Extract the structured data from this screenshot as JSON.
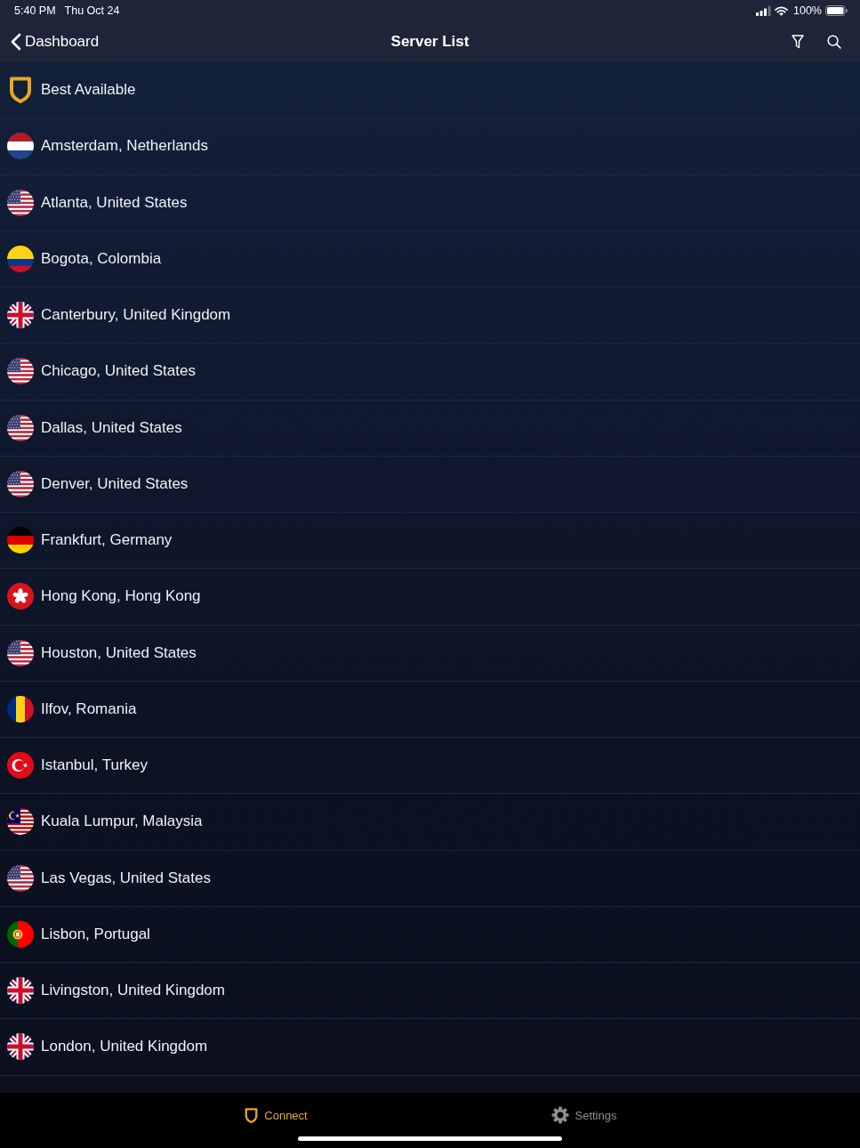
{
  "status_bar": {
    "time": "5:40 PM",
    "date": "Thu Oct 24",
    "battery": "100%"
  },
  "nav": {
    "back": "Dashboard",
    "title": "Server List"
  },
  "servers": [
    {
      "kind": "shield",
      "name": "Best Available"
    },
    {
      "kind": "nl",
      "name": "Amsterdam, Netherlands"
    },
    {
      "kind": "us",
      "name": "Atlanta, United States"
    },
    {
      "kind": "co",
      "name": "Bogota, Colombia"
    },
    {
      "kind": "gb",
      "name": "Canterbury, United Kingdom"
    },
    {
      "kind": "us",
      "name": "Chicago, United States"
    },
    {
      "kind": "us",
      "name": "Dallas, United States"
    },
    {
      "kind": "us",
      "name": "Denver, United States"
    },
    {
      "kind": "de",
      "name": "Frankfurt, Germany"
    },
    {
      "kind": "hk",
      "name": "Hong Kong, Hong Kong"
    },
    {
      "kind": "us",
      "name": "Houston, United States"
    },
    {
      "kind": "ro",
      "name": "Ilfov, Romania"
    },
    {
      "kind": "tr",
      "name": "Istanbul, Turkey"
    },
    {
      "kind": "my",
      "name": "Kuala Lumpur, Malaysia"
    },
    {
      "kind": "us",
      "name": "Las Vegas, United States"
    },
    {
      "kind": "pt",
      "name": "Lisbon, Portugal"
    },
    {
      "kind": "gb",
      "name": "Livingston, United Kingdom"
    },
    {
      "kind": "gb",
      "name": "London, United Kingdom"
    }
  ],
  "tabs": [
    {
      "kind": "shield",
      "label": "Connect",
      "selected": true
    },
    {
      "kind": "gear",
      "label": "Settings",
      "selected": false
    }
  ]
}
